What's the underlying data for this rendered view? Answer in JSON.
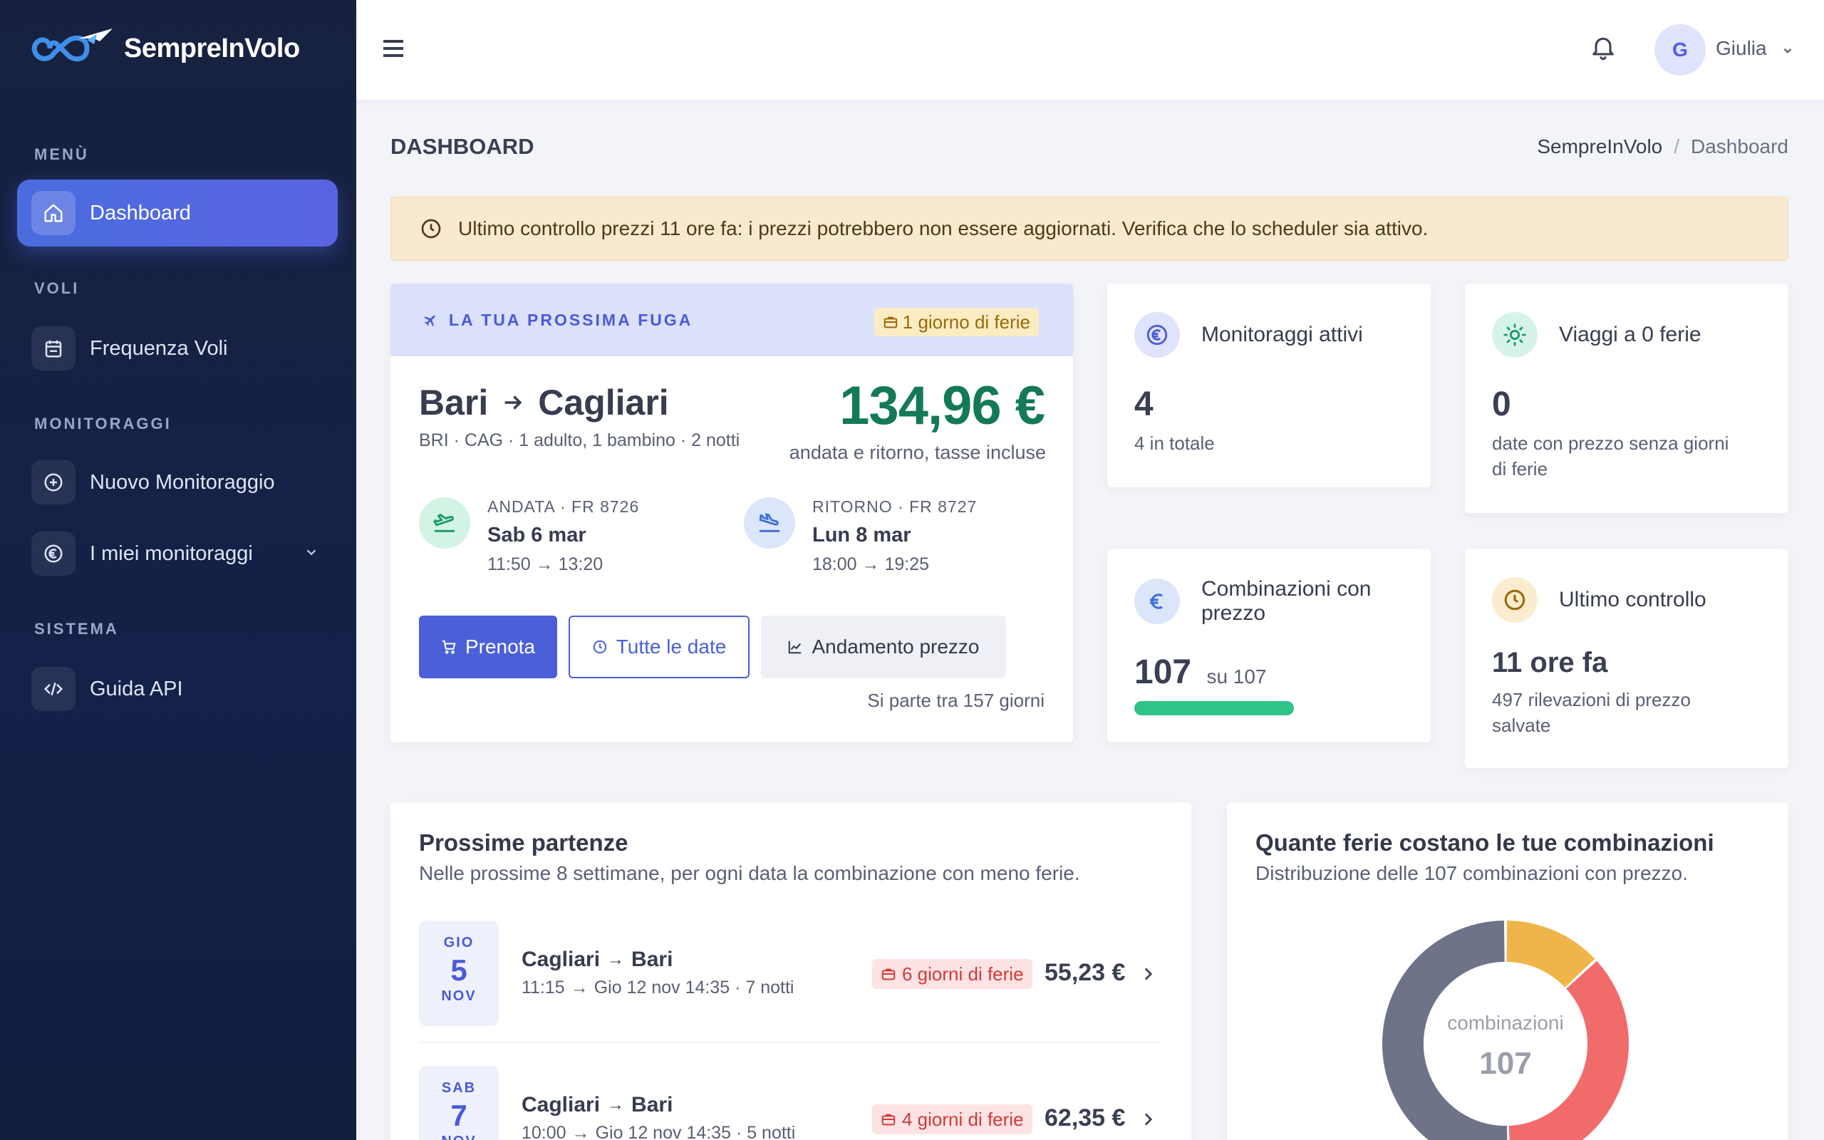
{
  "brand": {
    "name": "SempreInVolo"
  },
  "sidebar": {
    "sections": [
      {
        "heading": "MENÙ"
      },
      {
        "heading": "VOLI"
      },
      {
        "heading": "MONITORAGGI"
      },
      {
        "heading": "SISTEMA"
      }
    ],
    "items": [
      {
        "label": "Dashboard",
        "icon": "home-icon",
        "active": true
      },
      {
        "label": "Frequenza Voli",
        "icon": "calendar-icon"
      },
      {
        "label": "Nuovo Monitoraggio",
        "icon": "plus-circle-icon"
      },
      {
        "label": "I miei monitoraggi",
        "icon": "euro-circle-icon"
      },
      {
        "label": "Guida API",
        "icon": "code-icon"
      }
    ]
  },
  "topbar": {
    "user_initial": "G",
    "user_name": "Giulia"
  },
  "page": {
    "title": "DASHBOARD",
    "breadcrumb": {
      "root": "SempreInVolo",
      "separator": "/",
      "current": "Dashboard"
    }
  },
  "alert": {
    "text": "Ultimo controllo prezzi 11 ore fa: i prezzi potrebbero non essere aggiornati. Verifica che lo scheduler sia attivo."
  },
  "next_trip": {
    "header": "LA TUA PROSSIMA FUGA",
    "ferie_badge": "1 giorno di ferie",
    "origin": "Bari",
    "destination": "Cagliari",
    "details": "BRI · CAG · 1 adulto, 1 bambino · 2 notti",
    "price": "134,96 €",
    "price_note": "andata e ritorno, tasse incluse",
    "outbound": {
      "label": "ANDATA · FR 8726",
      "date": "Sab 6 mar",
      "time_from": "11:50",
      "time_to": "13:20"
    },
    "return": {
      "label": "RITORNO · FR 8727",
      "date": "Lun 8 mar",
      "time_from": "18:00",
      "time_to": "19:25"
    },
    "buttons": {
      "book": "Prenota",
      "all_dates": "Tutte le date",
      "price_trend": "Andamento prezzo"
    },
    "countdown": "Si parte tra 157 giorni"
  },
  "stats": {
    "active": {
      "title": "Monitoraggi attivi",
      "value": "4",
      "desc": "4 in totale"
    },
    "zero_ferie": {
      "title": "Viaggi a 0 ferie",
      "value": "0",
      "desc_line1": "date con prezzo senza giorni",
      "desc_line2": "di ferie"
    },
    "combos": {
      "title_line1": "Combinazioni con",
      "title_line2": "prezzo",
      "value": "107",
      "suffix": "su 107",
      "progress": 1.0
    },
    "last_check": {
      "title": "Ultimo controllo",
      "value": "11 ore fa",
      "desc_line1": "497 rilevazioni di prezzo",
      "desc_line2": "salvate"
    }
  },
  "departures": {
    "title": "Prossime partenze",
    "subtitle": "Nelle prossime 8 settimane, per ogni data la combinazione con meno ferie.",
    "rows": [
      {
        "dow": "GIO",
        "day": "5",
        "month": "NOV",
        "origin": "Cagliari",
        "destination": "Bari",
        "time_from": "11:15",
        "return_info": "Gio 12 nov 14:35 · 7 notti",
        "ferie": "6 giorni di ferie",
        "price": "55,23 €"
      },
      {
        "dow": "SAB",
        "day": "7",
        "month": "NOV",
        "origin": "Cagliari",
        "destination": "Bari",
        "time_from": "10:00",
        "return_info": "Gio 12 nov 14:35 · 5 notti",
        "ferie": "4 giorni di ferie",
        "price": "62,35 €"
      }
    ]
  },
  "donut": {
    "title": "Quante ferie costano le tue combinazioni",
    "subtitle": "Distribuzione delle 107 combinazioni con prezzo.",
    "center_label": "combinazioni",
    "center_value": "107"
  },
  "chart_data": {
    "type": "pie",
    "title": "Quante ferie costano le tue combinazioni",
    "total": 107,
    "slices": [
      {
        "value": 14,
        "color": "#f0b54a"
      },
      {
        "value": 39,
        "color": "#f26b6b"
      },
      {
        "value": 54,
        "color": "#6e7388"
      }
    ]
  }
}
